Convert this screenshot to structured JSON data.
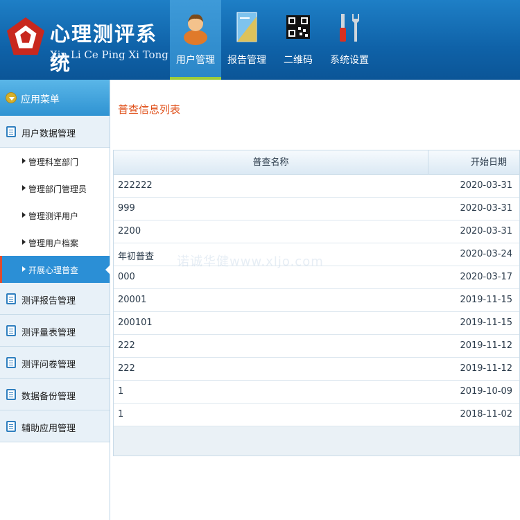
{
  "header": {
    "title": "心理测评系统",
    "subtitle": "Xin Li Ce Ping Xi Tong",
    "nav": [
      {
        "label": "用户管理",
        "icon": "user-icon"
      },
      {
        "label": "报告管理",
        "icon": "report-icon"
      },
      {
        "label": "二维码",
        "icon": "qrcode-icon"
      },
      {
        "label": "系统设置",
        "icon": "tools-icon"
      }
    ]
  },
  "sidebar": {
    "menu_title": "应用菜单",
    "groups": [
      {
        "label": "用户数据管理"
      },
      {
        "label": "测评报告管理"
      },
      {
        "label": "测评量表管理"
      },
      {
        "label": "测评问卷管理"
      },
      {
        "label": "数据备份管理"
      },
      {
        "label": "辅助应用管理"
      }
    ],
    "subitems": [
      {
        "label": "管理科室部门"
      },
      {
        "label": "管理部门管理员"
      },
      {
        "label": "管理测评用户"
      },
      {
        "label": "管理用户档案"
      },
      {
        "label": "开展心理普查"
      }
    ]
  },
  "main": {
    "title": "普查信息列表",
    "columns": {
      "name": "普查名称",
      "date": "开始日期"
    },
    "rows": [
      {
        "name": "222222",
        "date": "2020-03-31"
      },
      {
        "name": "999",
        "date": "2020-03-31"
      },
      {
        "name": "2200",
        "date": "2020-03-31"
      },
      {
        "name": "年初普查",
        "date": "2020-03-24"
      },
      {
        "name": "000",
        "date": "2020-03-17"
      },
      {
        "name": "20001",
        "date": "2019-11-15"
      },
      {
        "name": "200101",
        "date": "2019-11-15"
      },
      {
        "name": "222",
        "date": "2019-11-12"
      },
      {
        "name": "222",
        "date": "2019-11-12"
      },
      {
        "name": "1",
        "date": "2019-10-09"
      },
      {
        "name": "1",
        "date": "2018-11-02"
      }
    ]
  },
  "watermark": "诺诚华健www.xljo.com",
  "colors": {
    "header": "#1573b9",
    "accent": "#e0501a",
    "active": "#2b8fd6"
  }
}
